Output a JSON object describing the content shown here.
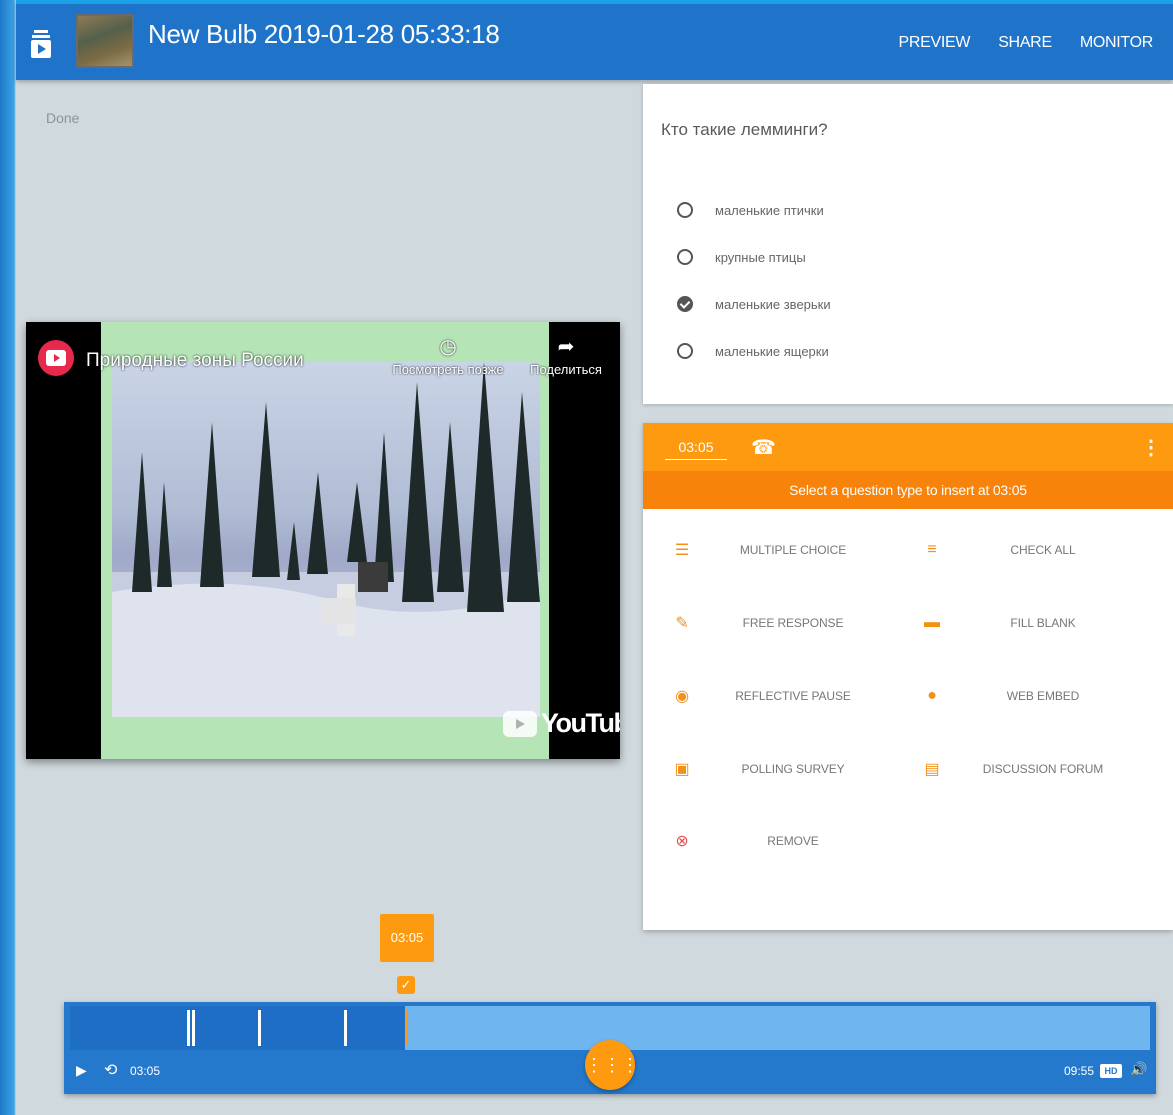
{
  "header": {
    "title": "New Bulb 2019-01-28 05:33:18",
    "nav": [
      "PREVIEW",
      "SHARE",
      "MONITOR"
    ]
  },
  "status": "Done",
  "video": {
    "title": "Природные зоны России",
    "watch_later": "Посмотреть позже",
    "share": "Поделиться",
    "brand": "YouTube"
  },
  "question": {
    "text": "Кто такие лемминги?",
    "options": [
      {
        "label": "маленькие птички",
        "checked": false
      },
      {
        "label": "крупные птицы",
        "checked": false
      },
      {
        "label": "маленькие зверьки",
        "checked": true
      },
      {
        "label": "маленькие ящерки",
        "checked": false
      }
    ]
  },
  "insert": {
    "time": "03:05",
    "prompt": "Select a question type to insert at 03:05",
    "types": [
      {
        "label": "MULTIPLE CHOICE",
        "icon": "list-icon"
      },
      {
        "label": "CHECK ALL",
        "icon": "checklist-icon"
      },
      {
        "label": "FREE RESPONSE",
        "icon": "pencil-icon"
      },
      {
        "label": "FILL BLANK",
        "icon": "blank-icon"
      },
      {
        "label": "REFLECTIVE PAUSE",
        "icon": "pause-circle-icon"
      },
      {
        "label": "WEB EMBED",
        "icon": "globe-icon"
      },
      {
        "label": "POLLING SURVEY",
        "icon": "poll-icon"
      },
      {
        "label": "DISCUSSION FORUM",
        "icon": "chat-icon"
      },
      {
        "label": "REMOVE",
        "icon": "remove-icon"
      }
    ]
  },
  "timeline": {
    "marker_time": "03:05",
    "current": "03:05",
    "duration": "09:55",
    "hd": "HD",
    "progress_fraction": 0.31,
    "tick_fractions": [
      0.108,
      0.113,
      0.174,
      0.254
    ]
  },
  "colors": {
    "header": "#1f74c9",
    "accent": "#fd9a10",
    "timeline": "#2479cc"
  }
}
